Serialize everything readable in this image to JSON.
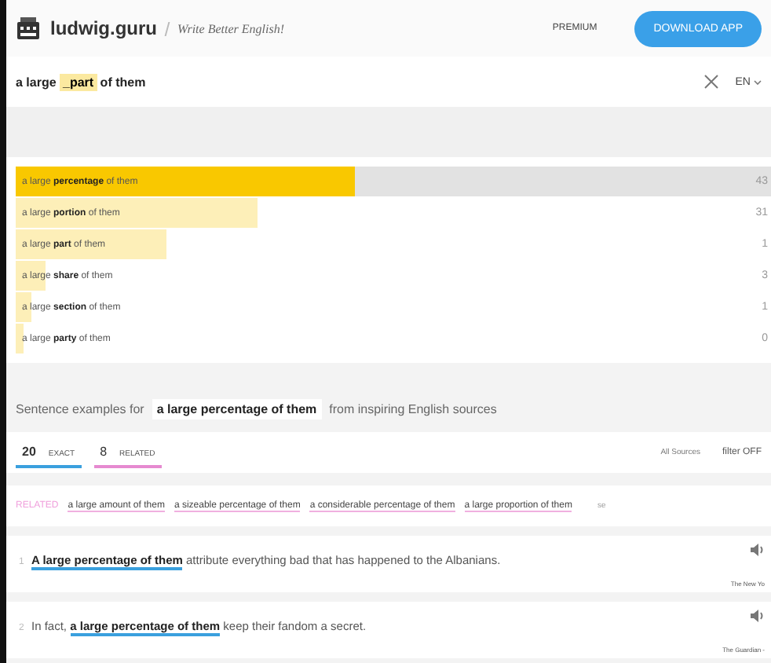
{
  "header": {
    "site": "ludwig.guru",
    "tagline": "Write Better English!",
    "premium": "PREMIUM",
    "download": "DOWNLOAD APP"
  },
  "search": {
    "before": "a large ",
    "highlight": "_part",
    "after": " of them",
    "language": "EN"
  },
  "results": [
    {
      "text": "a large **percentage** of them",
      "count": "43",
      "level": 0.45,
      "selected": true
    },
    {
      "text": "a large **portion** of them",
      "count": "31",
      "level": 0.32,
      "selected": false
    },
    {
      "text": "a large **part** of them",
      "count": "1",
      "level": 0.2,
      "selected": false
    },
    {
      "text": "a large **share** of them",
      "count": "3",
      "level": 0.04,
      "selected": false
    },
    {
      "text": "a large **section** of them",
      "count": "1",
      "level": 0.02,
      "selected": false
    },
    {
      "text": "a large **party** of them",
      "count": "0",
      "level": 0.01,
      "selected": false
    }
  ],
  "examples_heading": {
    "before": "Sentence examples for",
    "phrase": "a large percentage of them",
    "after": "from inspiring English sources"
  },
  "tabs": [
    {
      "count": "20",
      "label": "EXACT",
      "selected": true,
      "color": "#3aa0de"
    },
    {
      "count": "8",
      "label": "RELATED",
      "selected": false,
      "color": "#e68ad0"
    }
  ],
  "sources": "All Sources",
  "filter": "filter OFF",
  "related": {
    "label": "RELATED",
    "items": [
      "a large amount of them",
      "a sizeable percentage of them",
      "a considerable percentage of them",
      "a large proportion of them"
    ],
    "more": "se"
  },
  "examples": [
    {
      "number": "1",
      "text": "**A large percentage of them** attribute everything bad that has happened to the Albanians.",
      "source": "The New Yo"
    },
    {
      "number": "2",
      "text": "In fact, **a large percentage of them** keep their fandom a secret.",
      "source": "The Guardian -"
    }
  ]
}
